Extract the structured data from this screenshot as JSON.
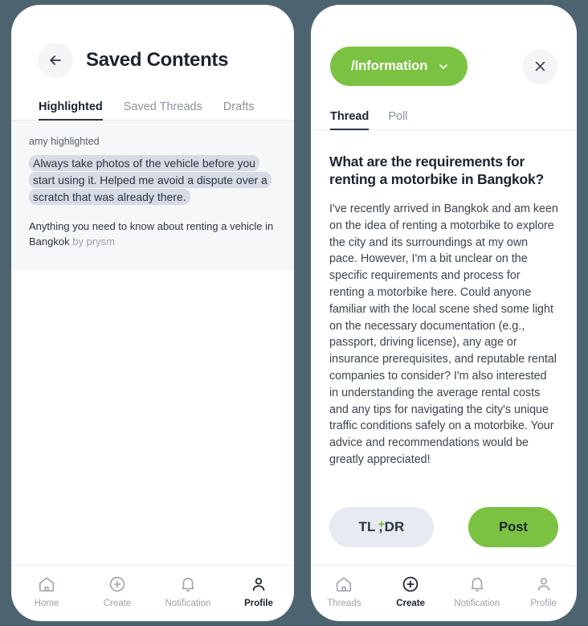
{
  "theme": {
    "background": "#4c6470",
    "panel": "#ffffff",
    "accent_green": "#7cc242",
    "text_dark": "#1c2430",
    "text_muted": "#9aa1ad",
    "highlight_mark": "#d7dbe3",
    "card_bg": "#f6f7f8"
  },
  "left_panel": {
    "back_icon": "arrow-left-icon",
    "title": "Saved Contents",
    "tabs": [
      {
        "label": "Highlighted",
        "active": true
      },
      {
        "label": "Saved Threads",
        "active": false
      },
      {
        "label": "Drafts",
        "active": false
      }
    ],
    "highlight_card": {
      "author_line": "amy highlighted",
      "quote": "Always take photos of the vehicle before you start using it. Helped me avoid a dispute over a scratch that was already there.",
      "source_title": "Anything you need to know about renting a vehicle in Bangkok",
      "source_by": "by prysm"
    },
    "bottom_nav": [
      {
        "label": "Home",
        "icon": "home-icon",
        "active": false
      },
      {
        "label": "Create",
        "icon": "plus-circle-icon",
        "active": false
      },
      {
        "label": "Notification",
        "icon": "bell-icon",
        "active": false
      },
      {
        "label": "Profile",
        "icon": "person-icon",
        "active": true
      }
    ]
  },
  "right_panel": {
    "channel_chip": {
      "label": "/Information",
      "chevron_icon": "chevron-down-icon"
    },
    "close_icon": "close-icon",
    "tabs": [
      {
        "label": "Thread",
        "active": true
      },
      {
        "label": "Poll",
        "active": false
      }
    ],
    "thread": {
      "title": "What are the requirements for renting a motorbike in Bangkok?",
      "body": "I've recently arrived in Bangkok and am keen on the idea of renting a motorbike to explore the city and its surroundings at my own pace. However, I'm a bit unclear on the specific requirements and process for renting a motorbike here. Could anyone familiar with the local scene shed some light on the necessary documentation (e.g., passport, driving license), any age or insurance prerequisites, and reputable rental companies to consider? I'm also interested in understanding the average rental costs and any tips for navigating the city's unique traffic conditions safely on a motorbike. Your advice and recommendations would be greatly appreciated!"
    },
    "actions": {
      "tldr_prefix": "TL",
      "tldr_suffix": "DR",
      "tldr_sparkle_icon": "sparkle-icon",
      "post_label": "Post"
    },
    "bottom_nav": [
      {
        "label": "Threads",
        "icon": "home-icon",
        "active": false
      },
      {
        "label": "Create",
        "icon": "plus-circle-icon",
        "active": true
      },
      {
        "label": "Notification",
        "icon": "bell-icon",
        "active": false
      },
      {
        "label": "Profile",
        "icon": "person-icon",
        "active": false
      }
    ]
  }
}
